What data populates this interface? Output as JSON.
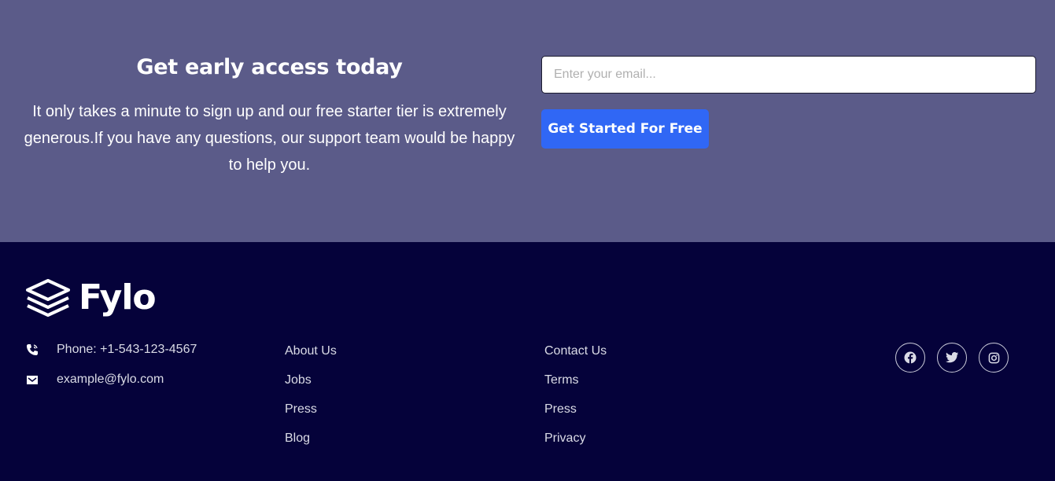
{
  "cta": {
    "title": "Get early access today",
    "text": "It only takes a minute to sign up and our free starter tier is extremely generous.If you have any questions, our support team would be happy to help you.",
    "email_placeholder": "Enter your email...",
    "button_label": "Get Started For Free"
  },
  "footer": {
    "logo_text": "Fylo",
    "phone": "Phone: +1-543-123-4567",
    "email": "example@fylo.com",
    "column1": [
      "About Us",
      "Jobs",
      "Press",
      "Blog"
    ],
    "column2": [
      "Contact Us",
      "Terms",
      "Press",
      "Privacy"
    ],
    "social_icons": [
      "facebook-icon",
      "twitter-icon",
      "instagram-icon"
    ]
  },
  "colors": {
    "cta_bg": "#5b5b89",
    "footer_bg": "#05023a",
    "button_bg": "#3067f5"
  }
}
